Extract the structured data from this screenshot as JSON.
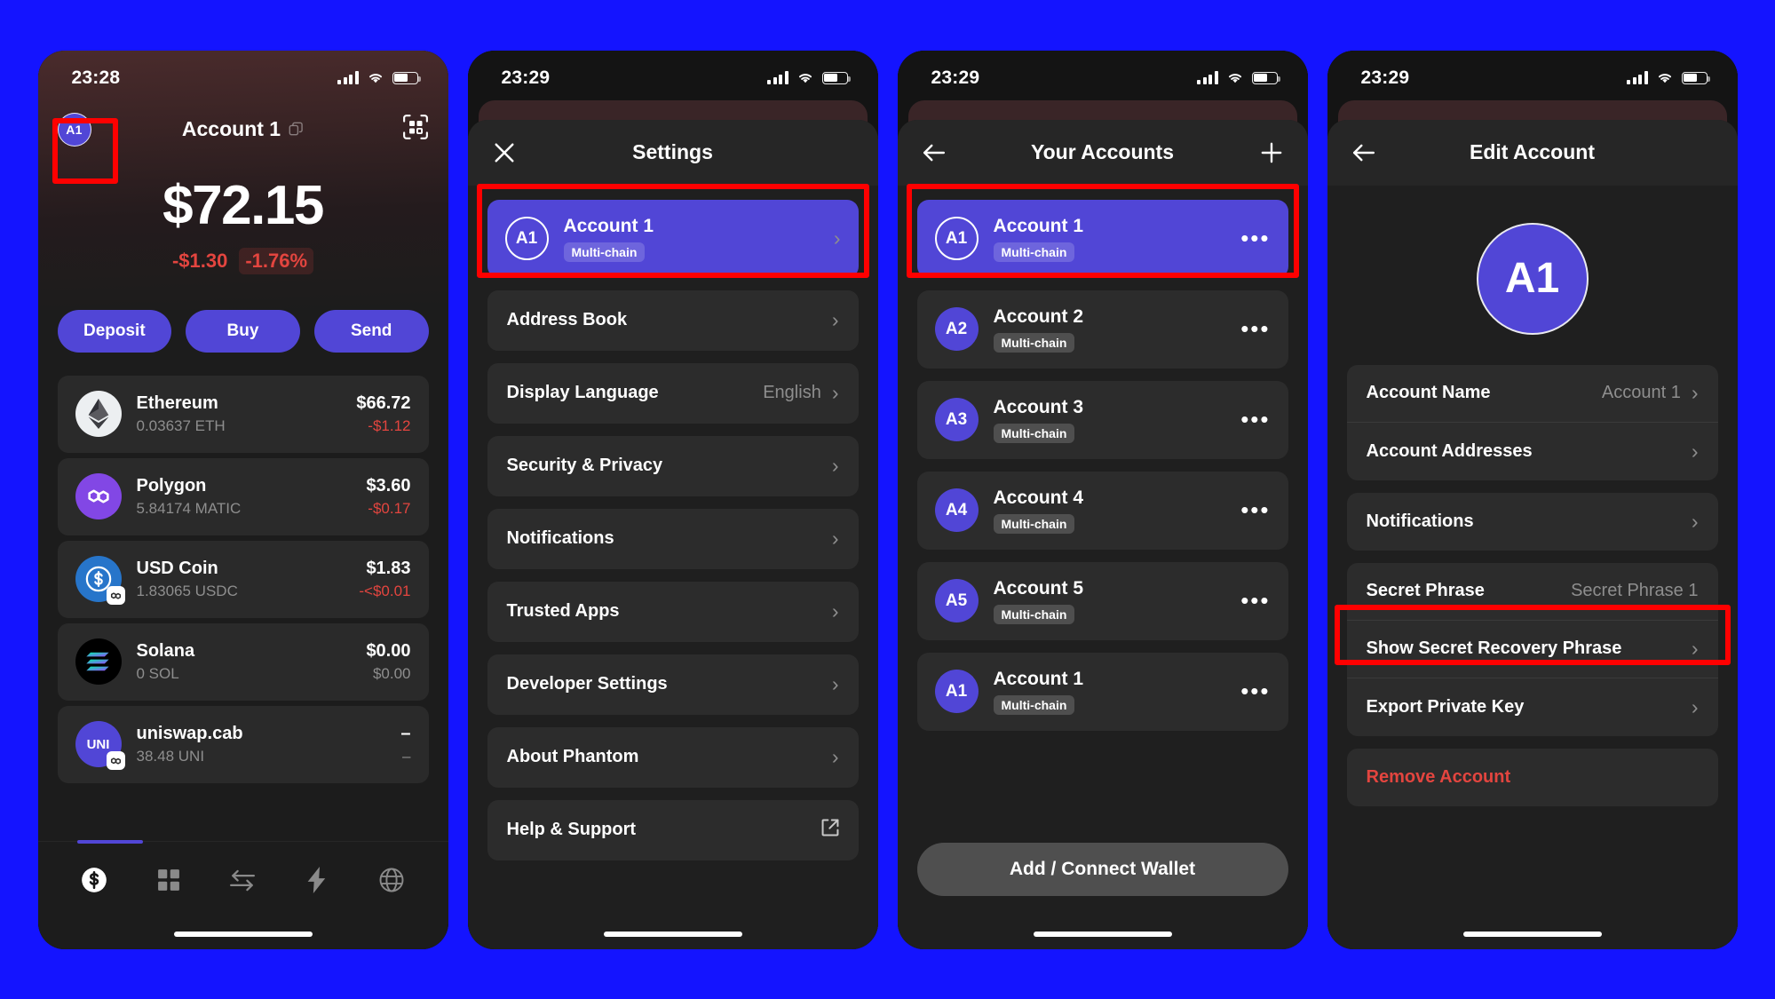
{
  "app": {
    "name": "Phantom"
  },
  "colors": {
    "accent": "#5146d6",
    "danger": "#e3453f",
    "highlight": "#ff0000",
    "sheet_bg": "#1f1f1f",
    "row_bg": "#2c2c2c"
  },
  "panel1": {
    "status": {
      "time": "23:28"
    },
    "header": {
      "avatar": "A1",
      "title": "Account 1",
      "copy_icon": "copy-icon",
      "scan_icon": "qr-scan-icon"
    },
    "balance": {
      "total": "$72.15",
      "change_amount": "-$1.30",
      "change_percent": "-1.76%"
    },
    "actions": [
      {
        "label": "Deposit"
      },
      {
        "label": "Buy"
      },
      {
        "label": "Send"
      }
    ],
    "tokens": [
      {
        "name": "Ethereum",
        "amount": "0.03637 ETH",
        "value": "$66.72",
        "change": "-$1.12",
        "icon": "ethereum-icon",
        "badge": false,
        "flat": false
      },
      {
        "name": "Polygon",
        "amount": "5.84174 MATIC",
        "value": "$3.60",
        "change": "-$0.17",
        "icon": "polygon-icon",
        "badge": false,
        "flat": false
      },
      {
        "name": "USD Coin",
        "amount": "1.83065 USDC",
        "value": "$1.83",
        "change": "-<$0.01",
        "icon": "usdc-icon",
        "badge": true,
        "flat": false
      },
      {
        "name": "Solana",
        "amount": "0 SOL",
        "value": "$0.00",
        "change": "$0.00",
        "icon": "solana-icon",
        "badge": false,
        "flat": true
      },
      {
        "name": "uniswap.cab",
        "amount": "38.48 UNI",
        "value": "–",
        "change": "–",
        "icon": "uniswap-icon",
        "badge": true,
        "flat": true
      }
    ],
    "tabs": [
      {
        "name": "tab-wallet",
        "icon": "dollar-coin-icon",
        "active": true
      },
      {
        "name": "tab-collectibles",
        "icon": "grid-icon",
        "active": false
      },
      {
        "name": "tab-swap",
        "icon": "swap-arrows-icon",
        "active": false
      },
      {
        "name": "tab-activity",
        "icon": "lightning-icon",
        "active": false
      },
      {
        "name": "tab-browser",
        "icon": "globe-icon",
        "active": false
      }
    ]
  },
  "panel2": {
    "status": {
      "time": "23:29"
    },
    "header": {
      "close_icon": "close-icon",
      "title": "Settings"
    },
    "account": {
      "avatar": "A1",
      "name": "Account 1",
      "chip": "Multi-chain"
    },
    "items": [
      {
        "label": "Address Book",
        "value": "",
        "trailing": "chevron"
      },
      {
        "label": "Display Language",
        "value": "English",
        "trailing": "chevron"
      },
      {
        "label": "Security & Privacy",
        "value": "",
        "trailing": "chevron"
      },
      {
        "label": "Notifications",
        "value": "",
        "trailing": "chevron"
      },
      {
        "label": "Trusted Apps",
        "value": "",
        "trailing": "chevron"
      },
      {
        "label": "Developer Settings",
        "value": "",
        "trailing": "chevron"
      },
      {
        "label": "About Phantom",
        "value": "",
        "trailing": "chevron"
      },
      {
        "label": "Help & Support",
        "value": "",
        "trailing": "external"
      }
    ]
  },
  "panel3": {
    "status": {
      "time": "23:29"
    },
    "header": {
      "back_icon": "back-arrow-icon",
      "title": "Your Accounts",
      "add_icon": "plus-icon"
    },
    "accounts": [
      {
        "avatar": "A1",
        "name": "Account 1",
        "chip": "Multi-chain",
        "active": true
      },
      {
        "avatar": "A2",
        "name": "Account 2",
        "chip": "Multi-chain",
        "active": false
      },
      {
        "avatar": "A3",
        "name": "Account 3",
        "chip": "Multi-chain",
        "active": false
      },
      {
        "avatar": "A4",
        "name": "Account 4",
        "chip": "Multi-chain",
        "active": false
      },
      {
        "avatar": "A5",
        "name": "Account 5",
        "chip": "Multi-chain",
        "active": false
      },
      {
        "avatar": "A1",
        "name": "Account 1",
        "chip": "Multi-chain",
        "active": false
      }
    ],
    "cta": {
      "label": "Add / Connect Wallet"
    }
  },
  "panel4": {
    "status": {
      "time": "23:29"
    },
    "header": {
      "back_icon": "back-arrow-icon",
      "title": "Edit Account"
    },
    "avatar": "A1",
    "group1": [
      {
        "label": "Account Name",
        "value": "Account 1",
        "trailing": "chevron",
        "danger": false
      },
      {
        "label": "Account Addresses",
        "value": "",
        "trailing": "chevron",
        "danger": false
      }
    ],
    "group2": [
      {
        "label": "Notifications",
        "value": "",
        "trailing": "chevron",
        "danger": false
      }
    ],
    "group3": [
      {
        "label": "Secret Phrase",
        "value": "Secret Phrase 1",
        "trailing": "none",
        "danger": false
      },
      {
        "label": "Show Secret Recovery Phrase",
        "value": "",
        "trailing": "chevron",
        "danger": false
      },
      {
        "label": "Export Private Key",
        "value": "",
        "trailing": "chevron",
        "danger": false
      }
    ],
    "group4": [
      {
        "label": "Remove Account",
        "value": "",
        "trailing": "none",
        "danger": true
      }
    ]
  }
}
